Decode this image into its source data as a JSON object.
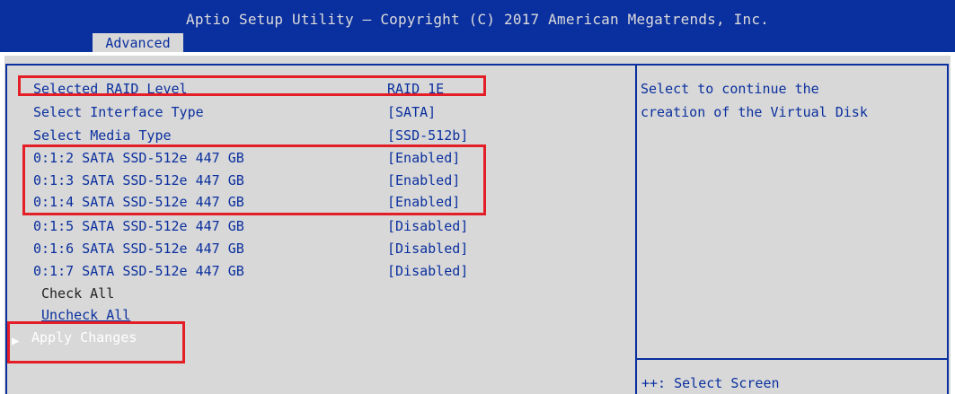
{
  "header": {
    "title": "Aptio Setup Utility – Copyright (C) 2017 American Megatrends, Inc.",
    "tab": "Advanced"
  },
  "settings": [
    {
      "label": "Selected RAID Level",
      "value": "RAID 1E"
    },
    {
      "label": "Select Interface Type",
      "value": "[SATA]"
    },
    {
      "label": "Select Media Type",
      "value": "[SSD-512b]"
    },
    {
      "label": "0:1:2 SATA SSD-512e 447 GB",
      "value": "[Enabled]"
    },
    {
      "label": "0:1:3 SATA SSD-512e 447 GB",
      "value": "[Enabled]"
    },
    {
      "label": "0:1:4 SATA SSD-512e 447 GB",
      "value": "[Enabled]"
    },
    {
      "label": "0:1:5 SATA SSD-512e 447 GB",
      "value": "[Disabled]"
    },
    {
      "label": "0:1:6 SATA SSD-512e 447 GB",
      "value": "[Disabled]"
    },
    {
      "label": "0:1:7 SATA SSD-512e 447 GB",
      "value": "[Disabled]"
    }
  ],
  "actions": {
    "check_all": "Check All",
    "uncheck_all": "Uncheck All",
    "apply_changes": "Apply Changes"
  },
  "help": {
    "text": "Select to continue the\ncreation of the Virtual Disk",
    "key_hint": "++: Select Screen"
  },
  "colors": {
    "header_bg": "#0a2f9e",
    "panel_bg": "#d8d8d8",
    "text": "#0a2f9e",
    "highlight_border": "#e41e26",
    "selected_text": "#ffffff"
  }
}
